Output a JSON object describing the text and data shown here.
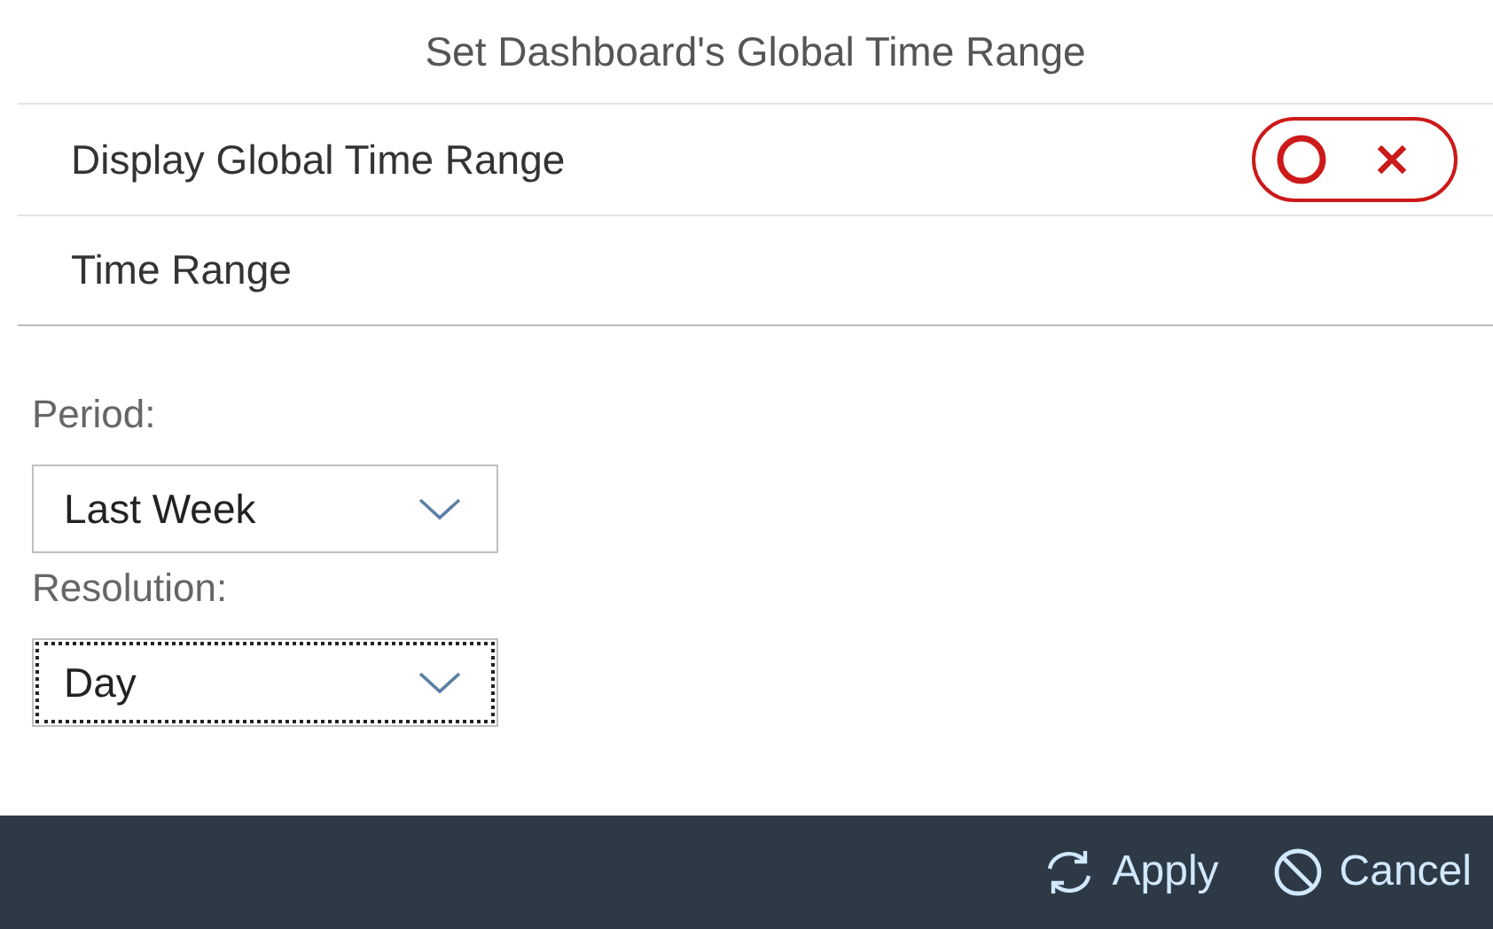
{
  "title": "Set Dashboard's Global Time Range",
  "rows": [
    {
      "kind": "toggle",
      "label": "Display Global Time Range",
      "on": false
    },
    {
      "kind": "text",
      "label": "Time Range"
    }
  ],
  "fields": [
    {
      "label": "Period:",
      "value": "Last Week",
      "focused": false
    },
    {
      "label": "Resolution:",
      "value": "Day",
      "focused": true
    }
  ],
  "footer": {
    "buttons": [
      {
        "kind": "apply",
        "label": "Apply"
      },
      {
        "kind": "cancel",
        "label": "Cancel"
      }
    ]
  }
}
